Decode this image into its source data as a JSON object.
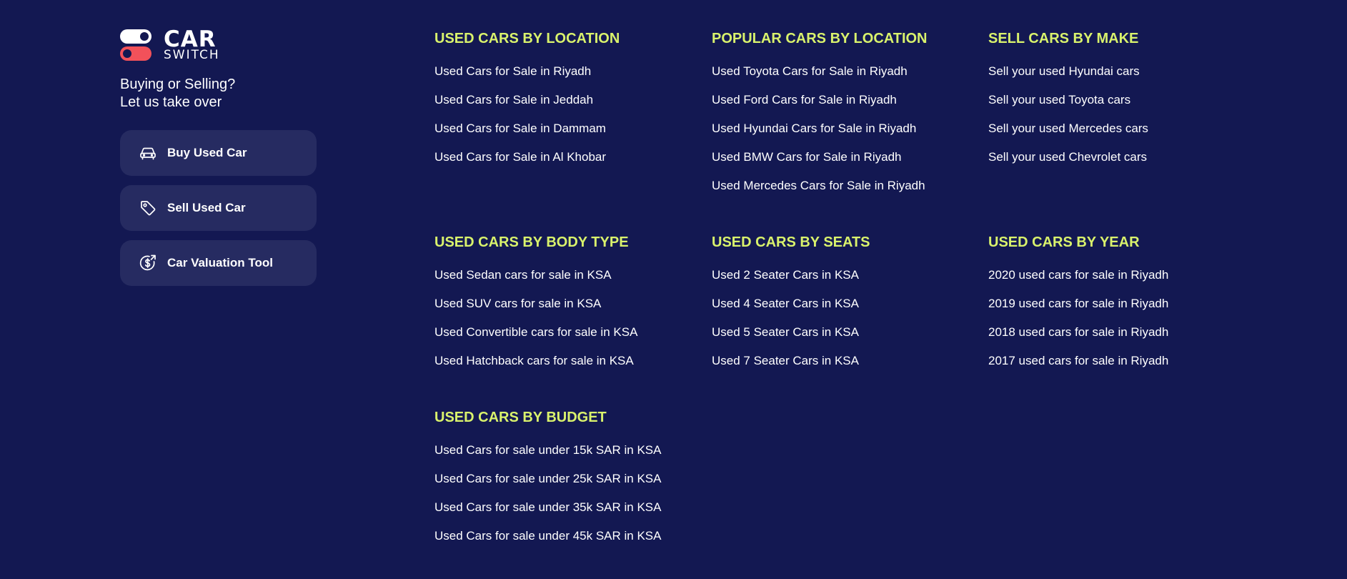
{
  "brand": {
    "logo_primary": "CAR",
    "logo_secondary": "SWITCH",
    "tagline_line1": "Buying or Selling?",
    "tagline_line2": "Let us take over"
  },
  "actions": [
    {
      "label": "Buy Used Car",
      "icon": "car-icon"
    },
    {
      "label": "Sell Used Car",
      "icon": "price-tag-icon"
    },
    {
      "label": "Car Valuation Tool",
      "icon": "dollar-circle-icon"
    }
  ],
  "sections": {
    "by_location": {
      "title": "USED CARS BY LOCATION",
      "links": [
        "Used Cars for Sale in Riyadh",
        "Used Cars for Sale in Jeddah",
        "Used Cars for Sale in Dammam",
        "Used Cars for Sale in Al Khobar"
      ]
    },
    "popular_by_location": {
      "title": "POPULAR CARS BY LOCATION",
      "links": [
        "Used Toyota Cars for Sale in Riyadh",
        "Used Ford Cars for Sale in Riyadh",
        "Used Hyundai Cars for Sale in Riyadh",
        "Used BMW Cars for Sale in Riyadh",
        "Used Mercedes Cars for Sale in Riyadh"
      ]
    },
    "sell_by_make": {
      "title": "SELL CARS BY MAKE",
      "links": [
        "Sell your used Hyundai cars",
        "Sell your used Toyota cars",
        "Sell your used Mercedes cars",
        "Sell your used Chevrolet cars"
      ]
    },
    "by_body_type": {
      "title": "USED CARS BY BODY TYPE",
      "links": [
        "Used Sedan cars for sale in KSA",
        "Used SUV cars for sale in KSA",
        "Used Convertible cars for sale in KSA",
        "Used Hatchback cars for sale in KSA"
      ]
    },
    "by_seats": {
      "title": "USED CARS BY SEATS",
      "links": [
        "Used 2 Seater Cars in KSA",
        "Used 4 Seater Cars in KSA",
        "Used 5 Seater Cars in KSA",
        "Used 7 Seater Cars in KSA"
      ]
    },
    "by_year": {
      "title": "USED CARS BY YEAR",
      "links": [
        "2020 used cars for sale in Riyadh",
        "2019 used cars for sale in Riyadh",
        "2018 used cars for sale in Riyadh",
        "2017 used cars for sale in Riyadh"
      ]
    },
    "by_budget": {
      "title": "USED CARS BY BUDGET",
      "links": [
        "Used Cars for sale under 15k SAR in KSA",
        "Used Cars for sale under 25k SAR in KSA",
        "Used Cars for sale under 35k SAR in KSA",
        "Used Cars for sale under 45k SAR in KSA"
      ]
    }
  },
  "colors": {
    "background": "#131852",
    "button_bg": "#262b61",
    "heading_accent": "#d9f26c",
    "logo_red": "#f2515a",
    "text": "#ffffff"
  }
}
